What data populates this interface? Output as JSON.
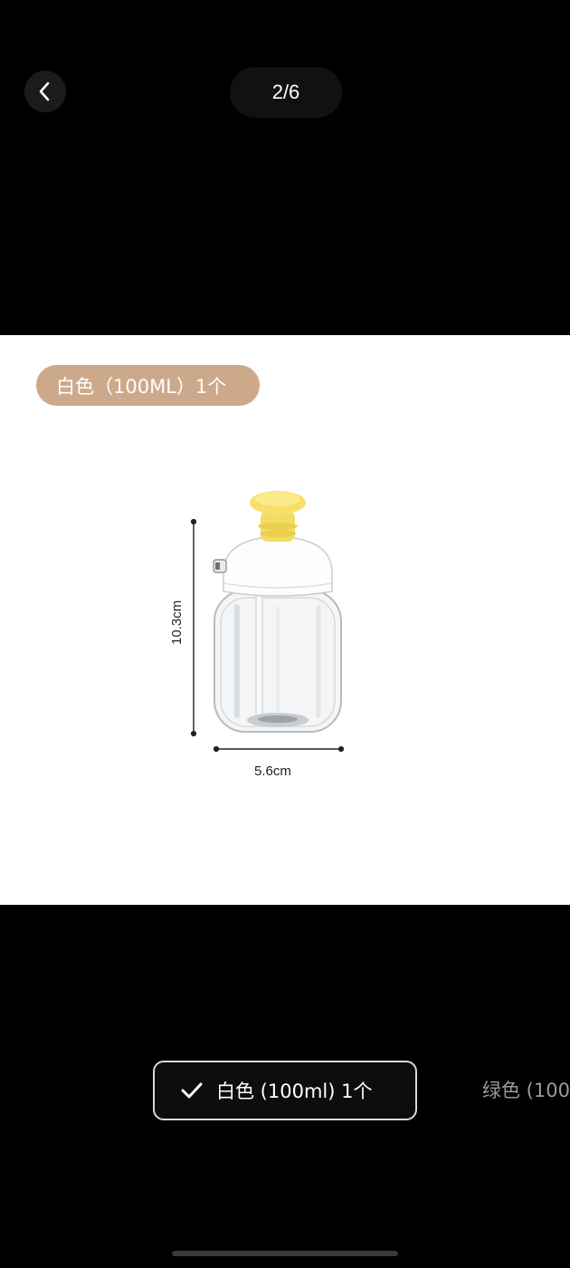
{
  "header": {
    "back_icon": "chevron-left-icon",
    "counter": "2/6"
  },
  "image": {
    "spec_label": "白色（100ML）1个",
    "width_label": "5.6cm",
    "height_label": "10.3cm",
    "colors": {
      "pill": "#cda98b",
      "cap": "#f6e06a"
    }
  },
  "variants": {
    "selected_label": "白色 (100ml) 1个",
    "selected_icon": "checkmark-icon",
    "other_label": "绿色 (100"
  }
}
